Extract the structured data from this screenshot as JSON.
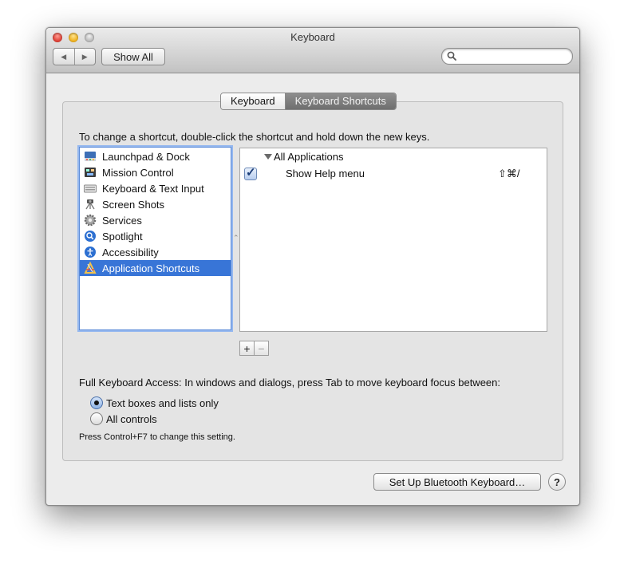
{
  "window": {
    "title": "Keyboard"
  },
  "toolbar": {
    "back_icon": "◀",
    "forward_icon": "▶",
    "show_all_label": "Show All",
    "search_placeholder": ""
  },
  "tabs": [
    {
      "label": "Keyboard",
      "selected": false
    },
    {
      "label": "Keyboard Shortcuts",
      "selected": true
    }
  ],
  "shortcuts": {
    "instruction": "To change a shortcut, double-click the shortcut and hold down the new keys.",
    "categories": [
      {
        "label": "Launchpad & Dock",
        "icon": "launchpad-dock-icon"
      },
      {
        "label": "Mission Control",
        "icon": "mission-control-icon"
      },
      {
        "label": "Keyboard & Text Input",
        "icon": "keyboard-icon"
      },
      {
        "label": "Screen Shots",
        "icon": "screen-shots-icon"
      },
      {
        "label": "Services",
        "icon": "services-gear-icon"
      },
      {
        "label": "Spotlight",
        "icon": "spotlight-icon"
      },
      {
        "label": "Accessibility",
        "icon": "accessibility-icon"
      },
      {
        "label": "Application Shortcuts",
        "icon": "application-shortcuts-icon",
        "selected": true
      }
    ],
    "group_label": "All Applications",
    "commands": [
      {
        "checked": true,
        "label": "Show Help menu",
        "keys": "⇧⌘/"
      }
    ],
    "add_label": "+",
    "remove_label": "−"
  },
  "full_keyboard_access": {
    "description": "Full Keyboard Access: In windows and dialogs, press Tab to move keyboard focus between:",
    "options": [
      {
        "label": "Text boxes and lists only",
        "selected": true
      },
      {
        "label": "All controls",
        "selected": false
      }
    ],
    "note": "Press Control+F7 to change this setting."
  },
  "footer": {
    "bluetooth_button": "Set Up Bluetooth Keyboard…",
    "help_label": "?"
  },
  "colors": {
    "selection": "#3875d7",
    "window_bg": "#ececec"
  }
}
